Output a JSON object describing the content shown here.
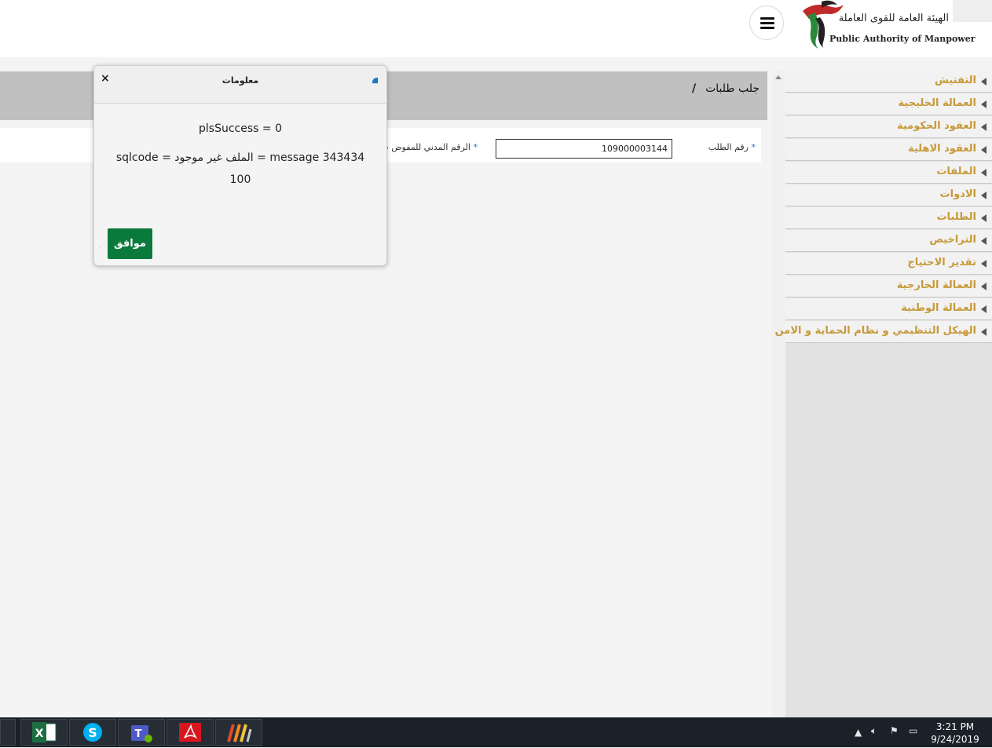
{
  "header": {
    "logo_ar": "الهيئة العامة للقوى العاملة",
    "logo_en": "Public Authority of Manpower",
    "menu_icon": "hamburger-icon"
  },
  "sidebar": {
    "items": [
      {
        "label": "التفتيش"
      },
      {
        "label": "العمالة الخليجية"
      },
      {
        "label": "العقود الحكومية"
      },
      {
        "label": "العقود الاهلية"
      },
      {
        "label": "الملفات"
      },
      {
        "label": "الادوات"
      },
      {
        "label": "الطلبات"
      },
      {
        "label": "التراخيص"
      },
      {
        "label": "تقدير الاحتياج"
      },
      {
        "label": "العمالة الخارجية"
      },
      {
        "label": "العمالة الوطنية"
      },
      {
        "label": "الهيكل التنظيمي و نظام الحماية و الامن"
      }
    ],
    "label_color": "#c69a3a"
  },
  "main": {
    "breadcrumb": "جلب طلبات",
    "breadcrumb_sep": "/",
    "request_no_label": "رقم الطلب",
    "request_no_value": "109000003144",
    "civil_id_label": "الرقم المدني للمفوض ب"
  },
  "dialog": {
    "title": "معلومات",
    "close_symbol": "×",
    "line1": "plsSuccess = 0",
    "line2": "sqlcode = الملف غير موجود = message 343434",
    "line3": "100",
    "ok_label": "موافق",
    "ok_color": "#0a7a3c"
  },
  "taskbar": {
    "apps": [
      "excel-icon",
      "skype-icon",
      "teams-icon",
      "acrobat-icon",
      "app-icon"
    ],
    "time": "3:21 PM",
    "date": "9/24/2019"
  }
}
